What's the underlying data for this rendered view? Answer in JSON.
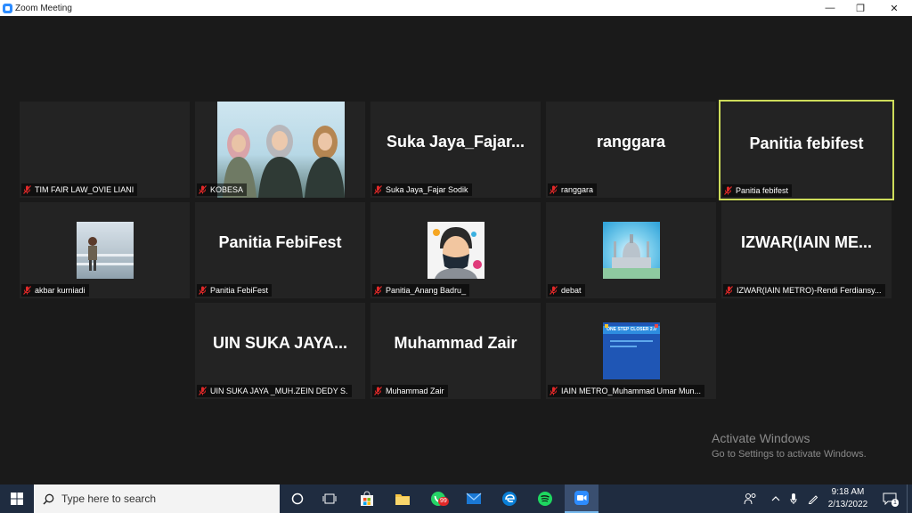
{
  "window": {
    "title": "Zoom Meeting",
    "minimize": "—",
    "restore": "❐",
    "close": "✕"
  },
  "tiles": [
    {
      "label": "TIM FAIR LAW_OVIE LIANI",
      "big": ""
    },
    {
      "label": "KOBESA",
      "big": ""
    },
    {
      "label": "Suka Jaya_Fajar Sodik",
      "big": "Suka  Jaya_Fajar..."
    },
    {
      "label": "ranggara",
      "big": "ranggara"
    },
    {
      "label": "Panitia febifest",
      "big": "Panitia febifest"
    },
    {
      "label": "akbar kurniadi",
      "big": ""
    },
    {
      "label": "Panitia FebiFest",
      "big": "Panitia FebiFest"
    },
    {
      "label": "Panitia_Anang Badru_",
      "big": ""
    },
    {
      "label": "debat",
      "big": ""
    },
    {
      "label": "IZWAR(IAIN METRO)-Rendi Ferdiansy...",
      "big": "IZWAR(IAIN  ME..."
    },
    {
      "label": "UIN SUKA JAYA _MUH.ZEIN DEDY S.",
      "big": "UIN  SUKA  JAYA..."
    },
    {
      "label": "Muhammad Zair",
      "big": "Muhammad Zair"
    },
    {
      "label": "IAIN METRO_Muhammad Umar Mun...",
      "big": ""
    }
  ],
  "poster_text": "ONE STEP CLOSER 2.0",
  "watermark": {
    "title": "Activate Windows",
    "subtitle": "Go to Settings to activate Windows."
  },
  "taskbar": {
    "search_placeholder": "Type here to search",
    "whatsapp_badge": "99",
    "time": "9:18 AM",
    "date": "2/13/2022",
    "notification_count": "1"
  },
  "colors": {
    "active_speaker_border": "#cddc5a",
    "mute_icon": "#e02828",
    "taskbar": "#1f2c40"
  }
}
